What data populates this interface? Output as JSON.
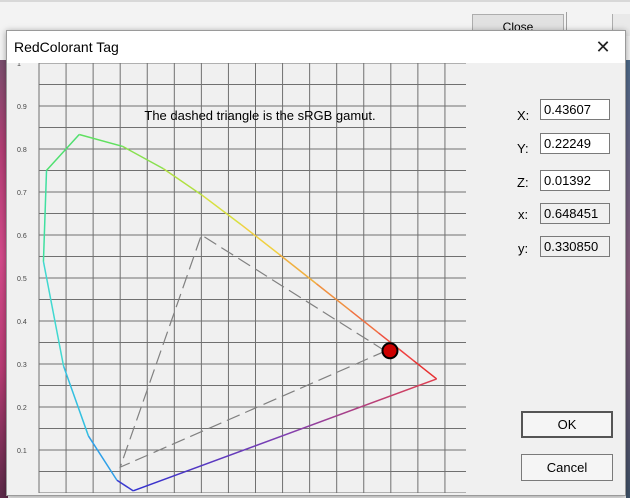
{
  "background": {
    "close_label": "Close"
  },
  "dialog": {
    "title": "RedColorant Tag",
    "close_glyph": "✕"
  },
  "chart_data": {
    "type": "scatter",
    "title": "The dashed triangle is the sRGB gamut.",
    "xlim": [
      0,
      0.8
    ],
    "ylim": [
      0,
      1
    ],
    "x_ticks_count": 16,
    "y_ticks": [
      "0.1",
      "0.2",
      "0.3",
      "0.4",
      "0.5",
      "0.6",
      "0.7",
      "0.8",
      "0.9",
      "1"
    ],
    "grid": true,
    "spectral_locus": [
      {
        "x": 0.1741,
        "y": 0.005
      },
      {
        "x": 0.144,
        "y": 0.0297
      },
      {
        "x": 0.0913,
        "y": 0.1327
      },
      {
        "x": 0.0454,
        "y": 0.295
      },
      {
        "x": 0.0082,
        "y": 0.5384
      },
      {
        "x": 0.0139,
        "y": 0.7502
      },
      {
        "x": 0.0743,
        "y": 0.8338
      },
      {
        "x": 0.1547,
        "y": 0.8059
      },
      {
        "x": 0.2296,
        "y": 0.7543
      },
      {
        "x": 0.3016,
        "y": 0.6923
      },
      {
        "x": 0.3731,
        "y": 0.6245
      },
      {
        "x": 0.4441,
        "y": 0.5547
      },
      {
        "x": 0.5125,
        "y": 0.4866
      },
      {
        "x": 0.5752,
        "y": 0.4242
      },
      {
        "x": 0.627,
        "y": 0.3725
      },
      {
        "x": 0.6658,
        "y": 0.334
      },
      {
        "x": 0.6915,
        "y": 0.3083
      },
      {
        "x": 0.7347,
        "y": 0.2653
      }
    ],
    "srgb_gamut": [
      {
        "x": 0.64,
        "y": 0.33
      },
      {
        "x": 0.3,
        "y": 0.6
      },
      {
        "x": 0.15,
        "y": 0.06
      }
    ],
    "point": {
      "x": 0.648451,
      "y": 0.33085,
      "color": "#cc0000"
    }
  },
  "fields": {
    "X": {
      "label": "X:",
      "value": "0.43607"
    },
    "Y": {
      "label": "Y:",
      "value": "0.22249"
    },
    "Z": {
      "label": "Z:",
      "value": "0.01392"
    },
    "x": {
      "label": "x:",
      "value": "0.648451"
    },
    "y": {
      "label": "y:",
      "value": "0.330850"
    }
  },
  "buttons": {
    "ok": "OK",
    "cancel": "Cancel"
  }
}
